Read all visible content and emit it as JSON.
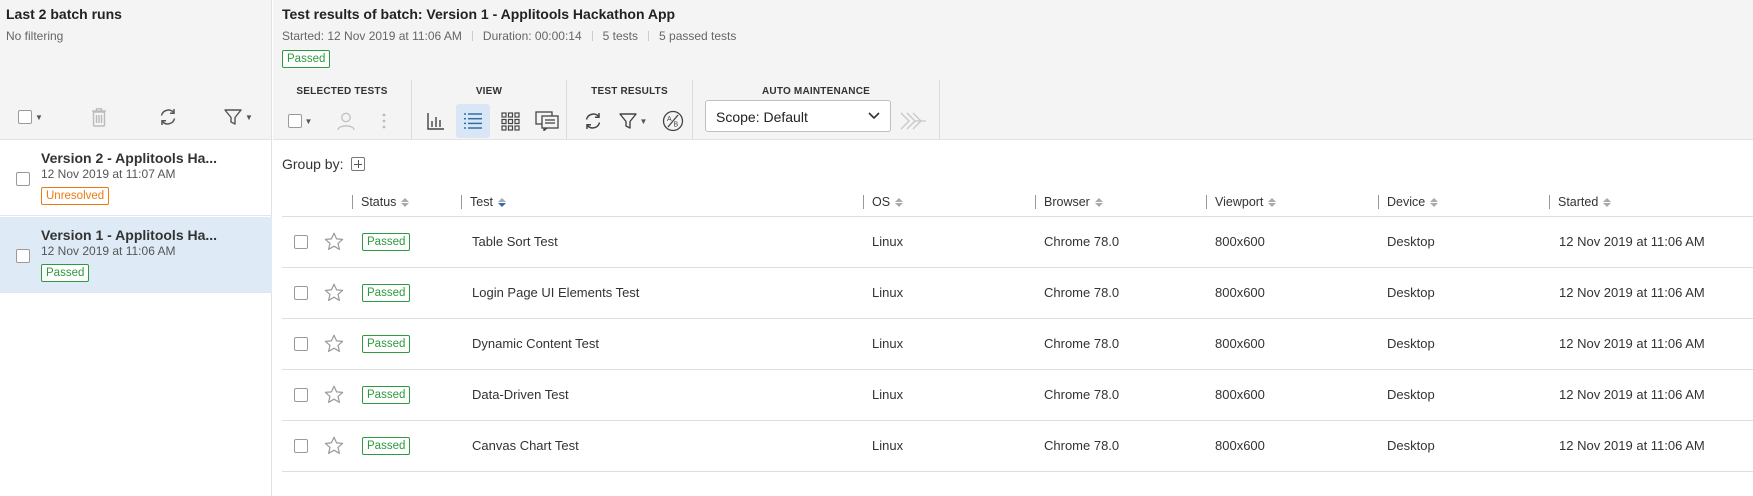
{
  "left_panel": {
    "title": "Last 2 batch runs",
    "filter_text": "No filtering",
    "batches": [
      {
        "name": "Version 2 - Applitools Ha...",
        "date": "12 Nov 2019 at 11:07 AM",
        "status": "Unresolved",
        "selected": false
      },
      {
        "name": "Version 1 - Applitools Ha...",
        "date": "12 Nov 2019 at 11:06 AM",
        "status": "Passed",
        "selected": true
      }
    ]
  },
  "header": {
    "title": "Test results of batch: Version 1 - Applitools Hackathon App",
    "started": "Started: 12 Nov 2019 at 11:06 AM",
    "duration": "Duration: 00:00:14",
    "tests_count": "5 tests",
    "passed_count": "5 passed tests",
    "status": "Passed"
  },
  "toolbar": {
    "selected_tests_label": "SELECTED TESTS",
    "view_label": "VIEW",
    "test_results_label": "TEST RESULTS",
    "auto_maintenance_label": "AUTO MAINTENANCE",
    "scope_value": "Scope: Default"
  },
  "group_by_label": "Group by:",
  "table": {
    "columns": [
      "Status",
      "Test",
      "OS",
      "Browser",
      "Viewport",
      "Device",
      "Started"
    ],
    "rows": [
      {
        "status": "Passed",
        "test": "Table Sort Test",
        "os": "Linux",
        "browser": "Chrome 78.0",
        "viewport": "800x600",
        "device": "Desktop",
        "started": "12 Nov 2019 at 11:06 AM"
      },
      {
        "status": "Passed",
        "test": "Login Page UI Elements Test",
        "os": "Linux",
        "browser": "Chrome 78.0",
        "viewport": "800x600",
        "device": "Desktop",
        "started": "12 Nov 2019 at 11:06 AM"
      },
      {
        "status": "Passed",
        "test": "Dynamic Content Test",
        "os": "Linux",
        "browser": "Chrome 78.0",
        "viewport": "800x600",
        "device": "Desktop",
        "started": "12 Nov 2019 at 11:06 AM"
      },
      {
        "status": "Passed",
        "test": "Data-Driven Test",
        "os": "Linux",
        "browser": "Chrome 78.0",
        "viewport": "800x600",
        "device": "Desktop",
        "started": "12 Nov 2019 at 11:06 AM"
      },
      {
        "status": "Passed",
        "test": "Canvas Chart Test",
        "os": "Linux",
        "browser": "Chrome 78.0",
        "viewport": "800x600",
        "device": "Desktop",
        "started": "12 Nov 2019 at 11:06 AM"
      }
    ]
  },
  "colors": {
    "passed": "#2d9a3f",
    "unresolved": "#ee7a12",
    "selected_row": "#deebf7",
    "panel_bg": "#f4f4f4"
  },
  "icons": [
    "checkbox",
    "caret-down-icon",
    "trash-icon",
    "refresh-icon",
    "filter-icon",
    "user-icon",
    "more-vertical-icon",
    "bar-chart-icon",
    "list-view-icon",
    "grid-view-icon",
    "compare-view-icon",
    "ab-compare-icon",
    "maintenance-icon",
    "plus-icon",
    "star-icon"
  ]
}
